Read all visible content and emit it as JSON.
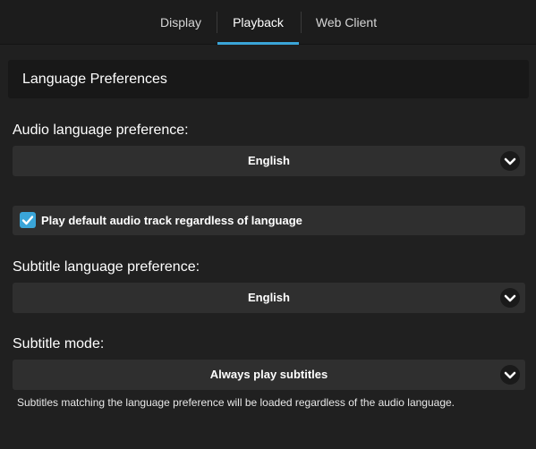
{
  "tabs": [
    {
      "label": "Display",
      "active": false
    },
    {
      "label": "Playback",
      "active": true
    },
    {
      "label": "Web Client",
      "active": false
    }
  ],
  "section": {
    "title": "Language Preferences"
  },
  "audio": {
    "label": "Audio language preference:",
    "value": "English"
  },
  "default_audio": {
    "label": "Play default audio track regardless of language",
    "checked": true
  },
  "subtitle_language": {
    "label": "Subtitle language preference:",
    "value": "English"
  },
  "subtitle_mode": {
    "label": "Subtitle mode:",
    "value": "Always play subtitles",
    "help": "Subtitles matching the language preference will be loaded regardless of the audio language."
  },
  "colors": {
    "accent": "#3aa5d8",
    "background": "#202020",
    "control": "#2f2f2f"
  },
  "icons": {
    "chevron": "chevron-down-icon",
    "check": "checkmark-icon"
  }
}
